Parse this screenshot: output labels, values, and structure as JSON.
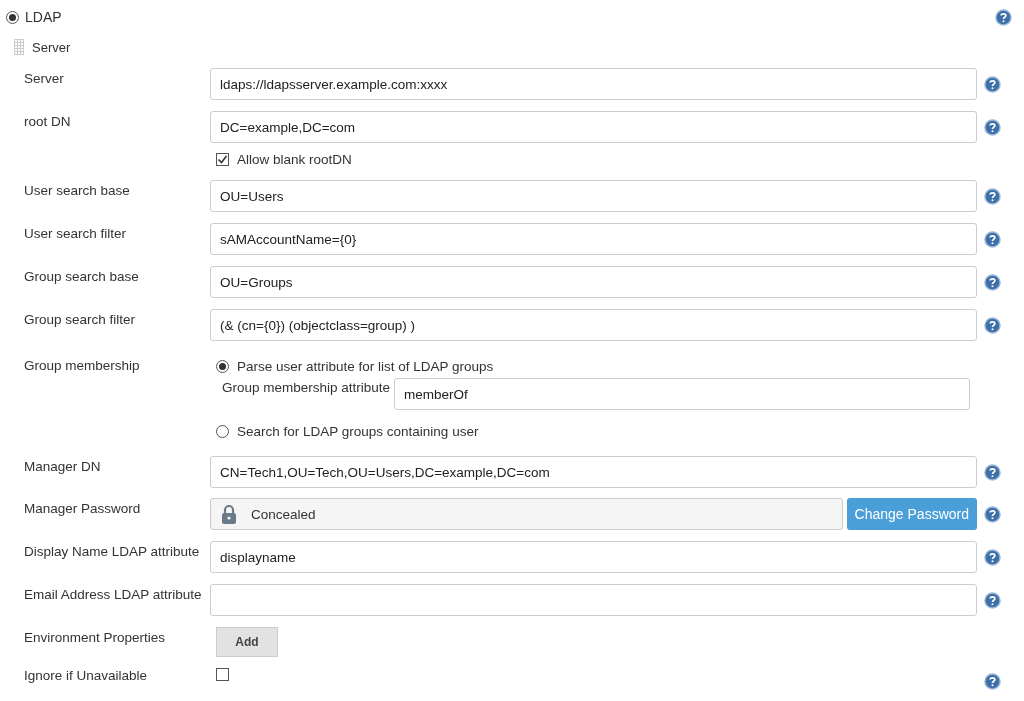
{
  "mode": {
    "label": "LDAP",
    "selected": true,
    "help": true
  },
  "section": {
    "title": "Server"
  },
  "fields": [
    {
      "kind": "text",
      "label": "Server",
      "value": "ldaps://ldapsserver.example.com:xxxx",
      "help": true
    },
    {
      "kind": "text",
      "label": "root DN",
      "value": "DC=example,DC=com",
      "help": true,
      "option": {
        "label": "Allow blank rootDN",
        "checked": true
      }
    },
    {
      "kind": "text",
      "label": "User search base",
      "value": "OU=Users",
      "help": true
    },
    {
      "kind": "text",
      "label": "User search filter",
      "value": "sAMAccountName={0}",
      "help": true
    },
    {
      "kind": "text",
      "label": "Group search base",
      "value": "OU=Groups",
      "help": true
    },
    {
      "kind": "text",
      "label": "Group search filter",
      "value": "(& (cn={0}) (objectclass=group) )",
      "help": true
    },
    {
      "kind": "radio",
      "label": "Group membership",
      "options": [
        {
          "label": "Parse user attribute for list of LDAP groups",
          "selected": true,
          "sub": {
            "label": "Group membership attribute",
            "value": "memberOf"
          }
        },
        {
          "label": "Search for LDAP groups containing user",
          "selected": false
        }
      ]
    },
    {
      "kind": "text",
      "label": "Manager DN",
      "value": "CN=Tech1,OU=Tech,OU=Users,DC=example,DC=com",
      "help": true
    },
    {
      "kind": "password",
      "label": "Manager Password",
      "value": "Concealed",
      "button": "Change Password",
      "help": true
    },
    {
      "kind": "text",
      "label": "Display Name LDAP attribute",
      "value": "displayname",
      "help": true
    },
    {
      "kind": "text",
      "label": "Email Address LDAP attribute",
      "help": true
    },
    {
      "kind": "button",
      "label": "Environment Properties",
      "button": "Add"
    },
    {
      "kind": "flag",
      "label": "Ignore if Unavailable",
      "checked": false,
      "help": true
    }
  ]
}
